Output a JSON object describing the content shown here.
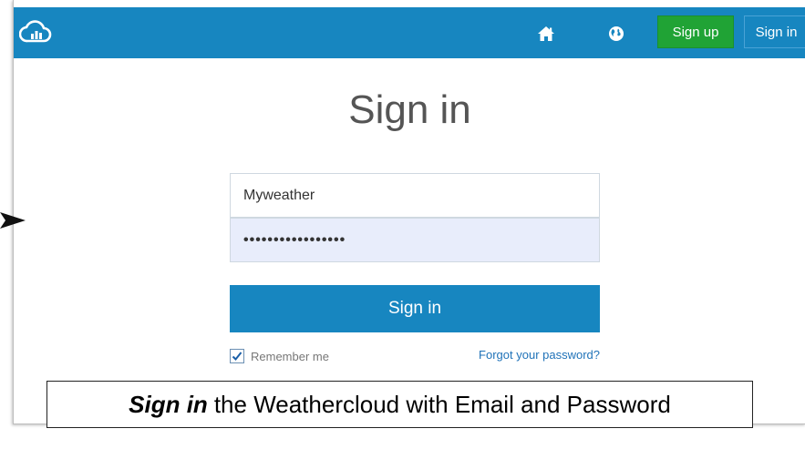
{
  "header": {
    "logo_icon": "cloud-chart-logo-icon",
    "home_icon": "home-icon",
    "globe_icon": "globe-icon",
    "signup_label": "Sign up",
    "signin_label": "Sign in"
  },
  "form": {
    "title": "Sign in",
    "username_value": "Myweather",
    "password_value": "•••••••••••••••••",
    "submit_label": "Sign in",
    "remember_label": "Remember me",
    "remember_checked": true,
    "forgot_label": "Forgot your password?"
  },
  "caption": {
    "emphasis": "Sign in",
    "text": "the Weathercloud with Email and Password"
  },
  "colors": {
    "brand_blue": "#1786c0",
    "signup_green": "#20a335",
    "password_fill": "#e8edfb"
  }
}
